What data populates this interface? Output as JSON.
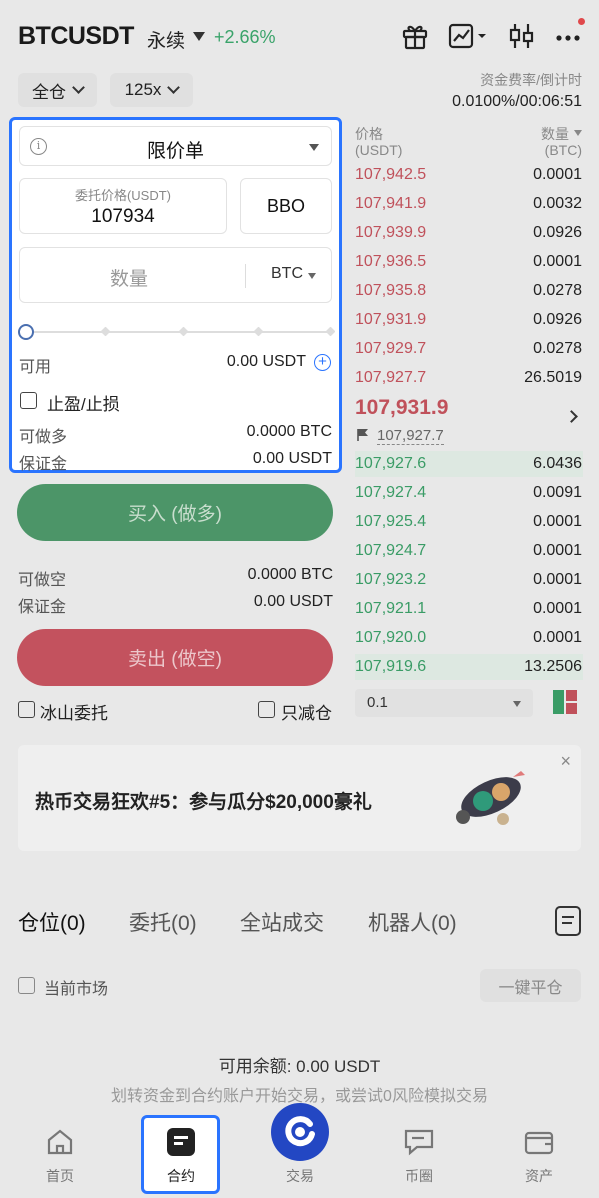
{
  "header": {
    "symbol": "BTCUSDT",
    "contract_type": "永续",
    "change": "+2.66%",
    "icons": [
      "gift-icon",
      "chart-icon",
      "candlestick-icon",
      "more-icon"
    ]
  },
  "controls": {
    "margin_mode": "全仓",
    "leverage": "125x",
    "funding_label": "资金费率/倒计时",
    "funding_value": "0.0100%/00:06:51"
  },
  "order_form": {
    "order_type": "限价单",
    "price_label": "委托价格(USDT)",
    "price_value": "107934",
    "bbo_label": "BBO",
    "qty_placeholder": "数量",
    "qty_unit": "BTC",
    "slider_percent": 0,
    "available_label": "可用",
    "available_value": "0.00 USDT",
    "tpsl_label": "止盈/止损",
    "long_max_label": "可做多",
    "long_max_value": "0.0000 BTC",
    "long_margin_label": "保证金",
    "long_margin_value": "0.00 USDT",
    "buy_label": "买入 (做多)",
    "short_max_label": "可做空",
    "short_max_value": "0.0000 BTC",
    "short_margin_label": "保证金",
    "short_margin_value": "0.00 USDT",
    "sell_label": "卖出 (做空)",
    "iceberg_label": "冰山委托",
    "reduce_only_label": "只减仓"
  },
  "orderbook": {
    "price_header": "价格",
    "price_unit": "(USDT)",
    "qty_header": "数量",
    "qty_unit": "(BTC)",
    "asks": [
      {
        "price": "107,942.5",
        "qty": "0.0001"
      },
      {
        "price": "107,941.9",
        "qty": "0.0032"
      },
      {
        "price": "107,939.9",
        "qty": "0.0926"
      },
      {
        "price": "107,936.5",
        "qty": "0.0001"
      },
      {
        "price": "107,935.8",
        "qty": "0.0278"
      },
      {
        "price": "107,931.9",
        "qty": "0.0926"
      },
      {
        "price": "107,929.7",
        "qty": "0.0278"
      },
      {
        "price": "107,927.7",
        "qty": "26.5019"
      }
    ],
    "last_price": "107,931.9",
    "mark_price": "107,927.7",
    "bids": [
      {
        "price": "107,927.6",
        "qty": "6.0436"
      },
      {
        "price": "107,927.4",
        "qty": "0.0091"
      },
      {
        "price": "107,925.4",
        "qty": "0.0001"
      },
      {
        "price": "107,924.7",
        "qty": "0.0001"
      },
      {
        "price": "107,923.2",
        "qty": "0.0001"
      },
      {
        "price": "107,921.1",
        "qty": "0.0001"
      },
      {
        "price": "107,920.0",
        "qty": "0.0001"
      },
      {
        "price": "107,919.6",
        "qty": "13.2506"
      }
    ],
    "precision": "0.1"
  },
  "banner": {
    "text": "热币交易狂欢#5：参与瓜分$20,000豪礼",
    "close": "×"
  },
  "tabs": [
    {
      "label": "仓位(0)"
    },
    {
      "label": "委托(0)"
    },
    {
      "label": "全站成交"
    },
    {
      "label": "机器人(0)"
    }
  ],
  "positions": {
    "current_market_label": "当前市场",
    "close_all_label": "一键平仓",
    "available_balance": "可用余额: 0.00 USDT",
    "hint": "划转资金到合约账户开始交易，或尝试0风险模拟交易"
  },
  "nav": [
    {
      "label": "首页",
      "icon": "home-icon"
    },
    {
      "label": "合约",
      "icon": "contract-icon"
    },
    {
      "label": "交易",
      "icon": "trade-icon"
    },
    {
      "label": "币圈",
      "icon": "chat-icon"
    },
    {
      "label": "资产",
      "icon": "wallet-icon"
    }
  ],
  "colors": {
    "accent": "#2a74ff",
    "buy": "#4c9568",
    "sell": "#c3525e",
    "ask_text": "#c0515b",
    "bid_text": "#3a9c66"
  }
}
